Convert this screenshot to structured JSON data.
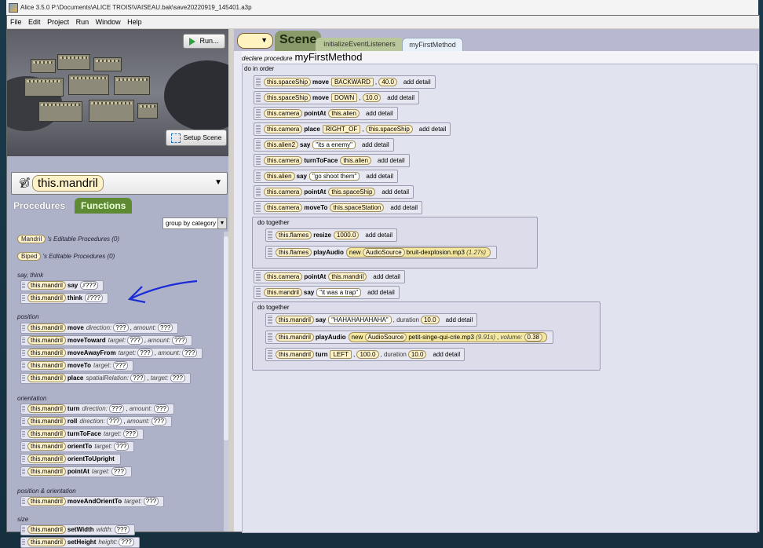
{
  "window": {
    "title": "Alice 3.5.0 P:\\Documents\\ALICE TROIS\\VAISEAU.bak\\save20220919_145401.a3p"
  },
  "menu": [
    "File",
    "Edit",
    "Project",
    "Run",
    "Window",
    "Help"
  ],
  "scene_view": {
    "run_label": "Run...",
    "setup_label": "Setup Scene"
  },
  "selector": {
    "object": "this.mandril"
  },
  "tabs": {
    "procedures": "Procedures",
    "functions": "Functions"
  },
  "group_by": "group by category",
  "editable": [
    {
      "cls": "Mandril",
      "text": "'s Editable Procedures (0)"
    },
    {
      "cls": "Biped",
      "text": "'s Editable Procedures (0)"
    }
  ],
  "categories": {
    "say_think": "say, think",
    "position": "position",
    "orientation": "orientation",
    "pos_orient": "position & orientation",
    "size": "size"
  },
  "procedures": {
    "obj": "this.mandril",
    "q": "???",
    "say": {
      "name": "say"
    },
    "think": {
      "name": "think"
    },
    "move": {
      "name": "move",
      "p1": "direction:",
      "p2": "amount:"
    },
    "moveToward": {
      "name": "moveToward",
      "p1": "target:",
      "p2": "amount:"
    },
    "moveAwayFrom": {
      "name": "moveAwayFrom",
      "p1": "target:",
      "p2": "amount:"
    },
    "moveTo": {
      "name": "moveTo",
      "p1": "target:"
    },
    "place": {
      "name": "place",
      "p1": "spatialRelation:",
      "p2": "target:"
    },
    "turn": {
      "name": "turn",
      "p1": "direction:",
      "p2": "amount:"
    },
    "roll": {
      "name": "roll",
      "p1": "direction:",
      "p2": "amount:"
    },
    "turnToFace": {
      "name": "turnToFace",
      "p1": "target:"
    },
    "orientTo": {
      "name": "orientTo",
      "p1": "target:"
    },
    "orientToUpright": {
      "name": "orientToUpright"
    },
    "pointAt": {
      "name": "pointAt",
      "p1": "target:"
    },
    "moveAndOrientTo": {
      "name": "moveAndOrientTo",
      "p1": "target:"
    },
    "setWidth": {
      "name": "setWidth",
      "p1": "width:"
    },
    "setHeight": {
      "name": "setHeight",
      "p1": "height:"
    }
  },
  "editor": {
    "scene_tab": "Scene",
    "init_tab": "initializeEventListeners",
    "method_tab": "myFirstMethod",
    "declare": "declare procedure",
    "method_name": "myFirstMethod",
    "do_in_order": "do in order",
    "do_together": "do together",
    "add_detail": "add detail",
    "new_label": "new",
    "audio_class": "AudioSource",
    "duration": ", duration",
    "volume": "volume:",
    "s1": {
      "obj": "this.spaceShip",
      "m": "move",
      "a": "BACKWARD",
      "b": "40.0"
    },
    "s2": {
      "obj": "this.spaceShip",
      "m": "move",
      "a": "DOWN",
      "b": "10.0"
    },
    "s3": {
      "obj": "this.camera",
      "m": "pointAt",
      "a": "this.alien"
    },
    "s4": {
      "obj": "this.camera",
      "m": "place",
      "a": "RIGHT_OF",
      "b": "this.spaceShip"
    },
    "s5": {
      "obj": "this.alien2",
      "m": "say",
      "a": "\"its a enemy\""
    },
    "s6": {
      "obj": "this.camera",
      "m": "turnToFace",
      "a": "this.alien"
    },
    "s7": {
      "obj": "this.alien",
      "m": "say",
      "a": "\"go shoot them\""
    },
    "s8": {
      "obj": "this.camera",
      "m": "pointAt",
      "a": "this.spaceShip"
    },
    "s9": {
      "obj": "this.camera",
      "m": "moveTo",
      "a": "this.spaceStation"
    },
    "g1a": {
      "obj": "this.flames",
      "m": "resize",
      "a": "1000.0"
    },
    "g1b": {
      "obj": "this.flames",
      "m": "playAudio",
      "file": "bruit-dexplosion.mp3",
      "len": "(1.27s)"
    },
    "s10": {
      "obj": "this.camera",
      "m": "pointAt",
      "a": "this.mandril"
    },
    "s11": {
      "obj": "this.mandril",
      "m": "say",
      "a": "\"it was a trap\""
    },
    "g2a": {
      "obj": "this.mandril",
      "m": "say",
      "a": "\"HAHAHAHAHAHA\"",
      "d": "10.0"
    },
    "g2b": {
      "obj": "this.mandril",
      "m": "playAudio",
      "file": "petit-singe-qui-crie.mp3",
      "len": "(9.91s)",
      "vol": "0.38"
    },
    "g2c": {
      "obj": "this.mandril",
      "m": "turn",
      "a": "LEFT",
      "b": "100.0",
      "d": "10.0"
    }
  },
  "colors": {
    "object_tile": "#fff2c8",
    "functions_tab": "#5f8a34",
    "annotation_arrow": "#1a2bd6"
  }
}
